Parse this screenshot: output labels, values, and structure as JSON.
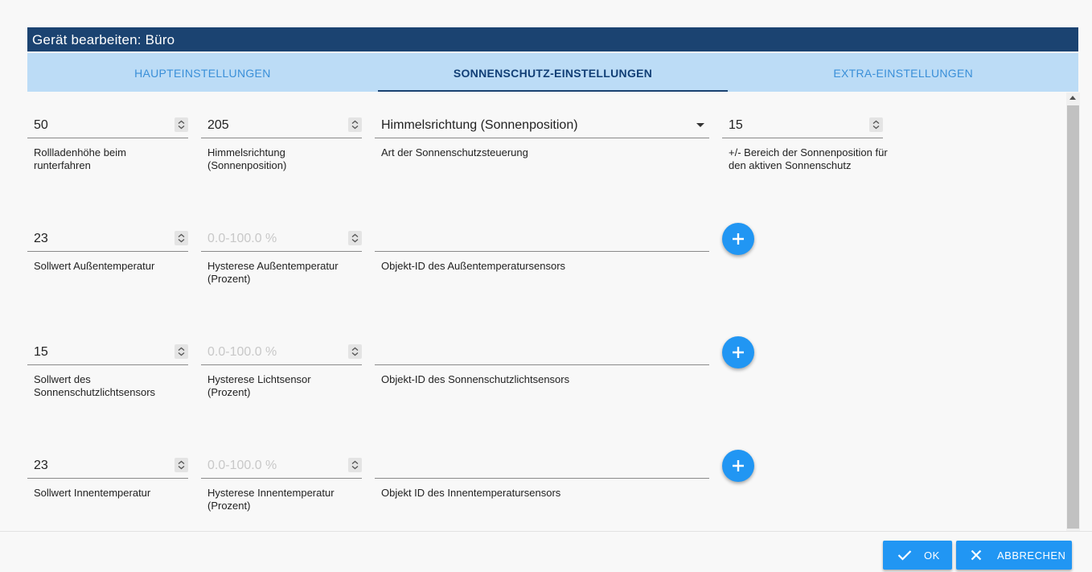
{
  "dialog": {
    "title": "Gerät bearbeiten: Büro"
  },
  "tabs": [
    {
      "label": "HAUPTEINSTELLUNGEN",
      "active": false
    },
    {
      "label": "SONNENSCHUTZ-EINSTELLUNGEN",
      "active": true
    },
    {
      "label": "EXTRA-EINSTELLUNGEN",
      "active": false
    }
  ],
  "rows": [
    {
      "fields": [
        {
          "value": "50",
          "label": "Rollladenhöhe beim runterfahren"
        },
        {
          "value": "205",
          "label": "Himmelsrichtung (Sonnenposition)"
        },
        {
          "value": "Himmelsrichtung (Sonnenposition)",
          "label": "Art der Sonnenschutzsteuerung"
        },
        {
          "value": "15",
          "label": "+/- Bereich der Sonnenposition für den aktiven Sonnenschutz"
        }
      ]
    },
    {
      "fields": [
        {
          "value": "23",
          "label": "Sollwert Außentemperatur"
        },
        {
          "placeholder": "0.0-100.0 %",
          "label": "Hysterese Außentemperatur (Prozent)"
        },
        {
          "value": "",
          "label": "Objekt-ID des Außentemperatursensors"
        }
      ]
    },
    {
      "fields": [
        {
          "value": "15",
          "label": "Sollwert des Sonnenschutzlichtsensors"
        },
        {
          "placeholder": "0.0-100.0 %",
          "label": "Hysterese Lichtsensor (Prozent)"
        },
        {
          "value": "",
          "label": "Objekt-ID des Sonnenschutzlichtsensors"
        }
      ]
    },
    {
      "fields": [
        {
          "value": "23",
          "label": "Sollwert Innentemperatur"
        },
        {
          "placeholder": "0.0-100.0 %",
          "label": "Hysterese Innentemperatur (Prozent)"
        },
        {
          "value": "",
          "label": "Objekt ID des Innentemperatursensors"
        }
      ]
    }
  ],
  "buttons": {
    "ok": "OK",
    "cancel": "ABBRECHEN"
  },
  "icons": {
    "add": "plus-icon",
    "ok": "check-icon",
    "cancel": "close-icon",
    "spinner": "spinner-icon",
    "dropdown": "dropdown-arrow-icon"
  },
  "colors": {
    "title_bar": "#1b4371",
    "tab_bar": "#bcdcf6",
    "accent": "#2196f3"
  }
}
